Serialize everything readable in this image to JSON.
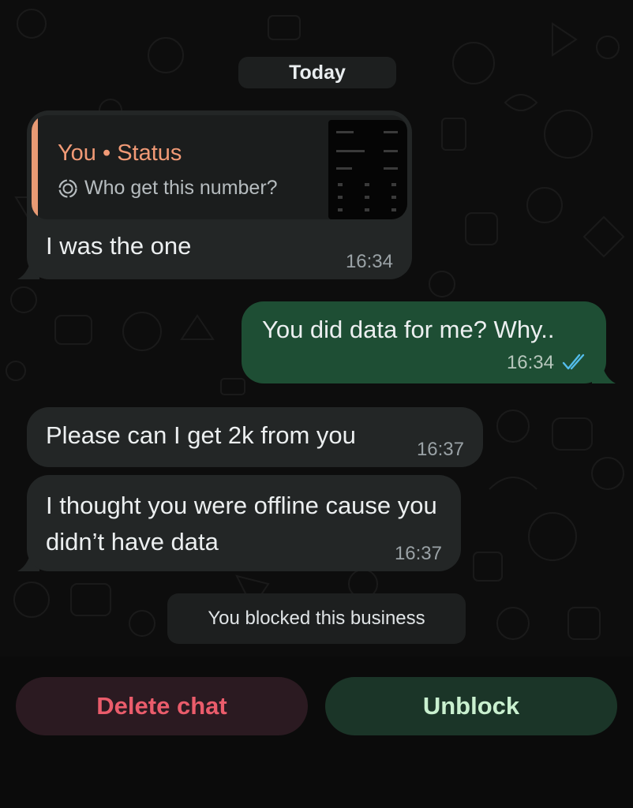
{
  "chat": {
    "date_label": "Today",
    "messages": [
      {
        "direction": "incoming",
        "quoted": {
          "sender": "You • Status",
          "text": "Who get this number?"
        },
        "text": "I was the one",
        "time": "16:34"
      },
      {
        "direction": "outgoing",
        "text": "You did data for me? Why..",
        "time": "16:34",
        "status": "read"
      },
      {
        "direction": "incoming",
        "text": "Please can I get 2k from you",
        "time": "16:37"
      },
      {
        "direction": "incoming",
        "text": "I thought you were offline cause you didn’t have data",
        "time": "16:37"
      }
    ],
    "system_notice": "You blocked this business"
  },
  "actions": {
    "delete_label": "Delete chat",
    "unblock_label": "Unblock"
  },
  "colors": {
    "incoming_bubble": "#232626",
    "outgoing_bubble": "#1e4e34",
    "quote_accent": "#e89a74",
    "read_ticks": "#53bdeb",
    "delete_text": "#ea5c6b",
    "unblock_text": "#c9f0cf"
  },
  "icons": {
    "status_icon": "status-ring-icon",
    "read_receipt": "double-check-icon"
  }
}
